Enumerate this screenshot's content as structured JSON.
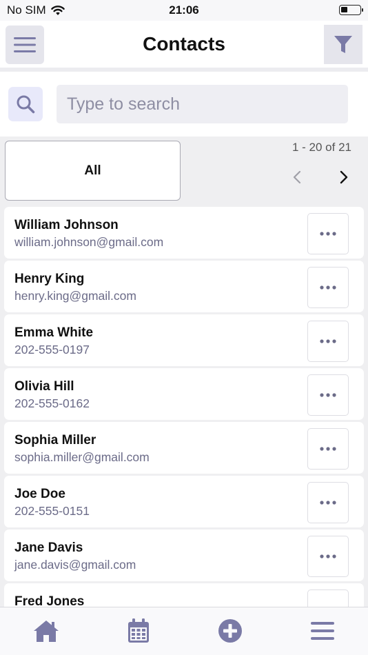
{
  "status_bar": {
    "carrier": "No SIM",
    "time": "21:06",
    "icons": [
      "wifi-icon",
      "battery-icon"
    ]
  },
  "header": {
    "title": "Contacts",
    "menu_icon": "hamburger-icon",
    "filter_icon": "funnel-icon"
  },
  "search": {
    "placeholder": "Type to search",
    "value": "",
    "icon": "search-icon"
  },
  "filter": {
    "tab_label": "All",
    "pagination": "1 - 20 of 21"
  },
  "contacts": [
    {
      "name": "William Johnson",
      "detail": "william.johnson@gmail.com"
    },
    {
      "name": "Henry King",
      "detail": "henry.king@gmail.com"
    },
    {
      "name": "Emma White",
      "detail": "202-555-0197"
    },
    {
      "name": "Olivia Hill",
      "detail": "202-555-0162"
    },
    {
      "name": "Sophia Miller",
      "detail": "sophia.miller@gmail.com"
    },
    {
      "name": "Joe Doe",
      "detail": "202-555-0151"
    },
    {
      "name": "Jane Davis",
      "detail": "jane.davis@gmail.com"
    },
    {
      "name": "Fred Jones",
      "detail": ""
    }
  ],
  "tab_bar": {
    "tabs": [
      "home-icon",
      "calendar-icon",
      "add-circle-icon",
      "menu-icon"
    ]
  },
  "colors": {
    "accent": "#7a7aa6",
    "background": "#efeff1",
    "detail_text": "#6b6b88"
  }
}
